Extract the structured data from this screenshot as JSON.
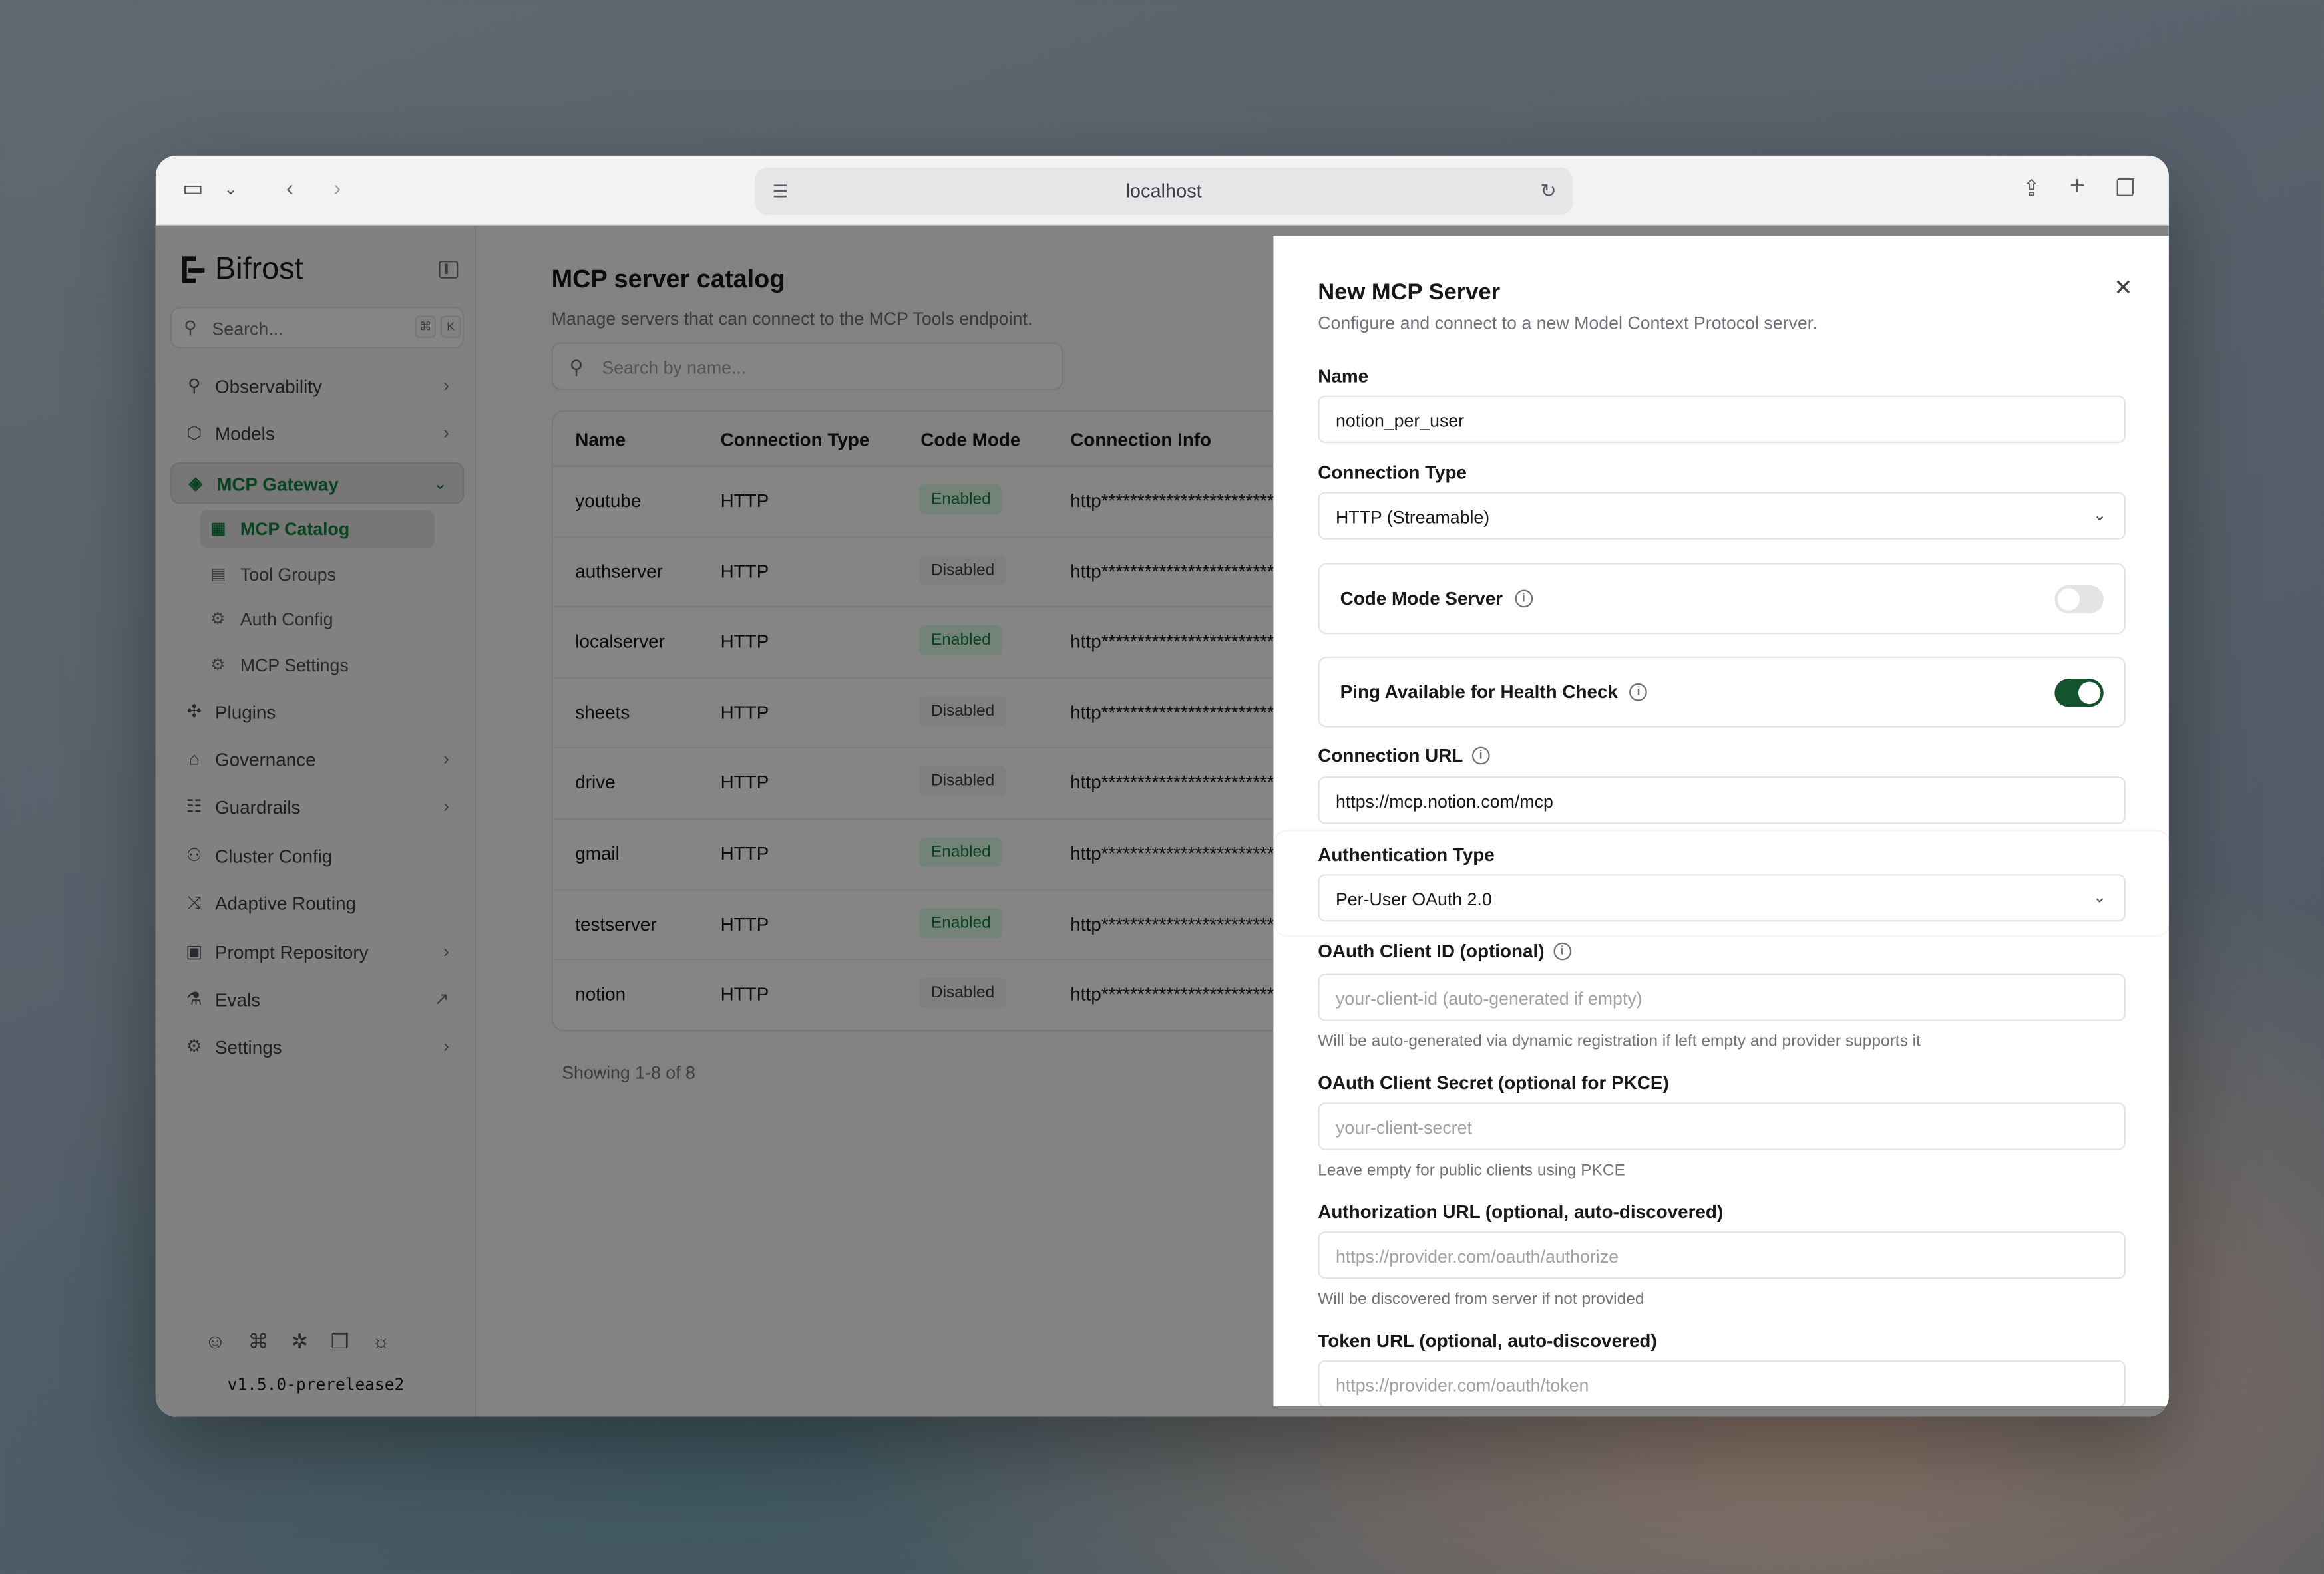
{
  "browser": {
    "url": "localhost"
  },
  "sidebar": {
    "brand": "Bifrost",
    "search_placeholder": "Search...",
    "search_shortcut": [
      "⌘",
      "K"
    ],
    "items": [
      {
        "label": "Observability",
        "icon": "telescope-icon",
        "glyph": "⚲",
        "trailing": "›"
      },
      {
        "label": "Models",
        "icon": "cube-icon",
        "glyph": "⬡",
        "trailing": "›"
      },
      {
        "label": "MCP Gateway",
        "icon": "mcp-icon",
        "glyph": "◈",
        "trailing": "⌄"
      },
      {
        "label": "Plugins",
        "icon": "puzzle-icon",
        "glyph": "✣",
        "trailing": ""
      },
      {
        "label": "Governance",
        "icon": "bank-icon",
        "glyph": "⌂",
        "trailing": "›"
      },
      {
        "label": "Guardrails",
        "icon": "guardrail-icon",
        "glyph": "☷",
        "trailing": "›"
      },
      {
        "label": "Cluster Config",
        "icon": "network-icon",
        "glyph": "⚇",
        "trailing": ""
      },
      {
        "label": "Adaptive Routing",
        "icon": "shuffle-icon",
        "glyph": "⤨",
        "trailing": ""
      },
      {
        "label": "Prompt Repository",
        "icon": "folder-icon",
        "glyph": "▣",
        "trailing": "›"
      },
      {
        "label": "Evals",
        "icon": "flask-icon",
        "glyph": "⚗",
        "trailing": "↗"
      },
      {
        "label": "Settings",
        "icon": "sliders-icon",
        "glyph": "⚙",
        "trailing": "›"
      }
    ],
    "sub_items": [
      {
        "label": "MCP Catalog",
        "icon": "grid-icon",
        "glyph": "▦"
      },
      {
        "label": "Tool Groups",
        "icon": "toolbox-icon",
        "glyph": "▤"
      },
      {
        "label": "Auth Config",
        "icon": "gear-icon",
        "glyph": "⚙"
      },
      {
        "label": "MCP Settings",
        "icon": "cog-icon",
        "glyph": "⚙"
      }
    ],
    "footer_icons": [
      {
        "icon": "discord-icon",
        "glyph": "☺"
      },
      {
        "icon": "github-icon",
        "glyph": "⌘"
      },
      {
        "icon": "bug-icon",
        "glyph": "✲"
      },
      {
        "icon": "book-icon",
        "glyph": "❐"
      },
      {
        "icon": "sun-icon",
        "glyph": "☼"
      }
    ],
    "version": "v1.5.0-prerelease2"
  },
  "catalog": {
    "title": "MCP server catalog",
    "subtitle": "Manage servers that can connect to the MCP Tools endpoint.",
    "search_placeholder": "Search by name...",
    "columns": [
      "Name",
      "Connection Type",
      "Code Mode",
      "Connection Info"
    ],
    "rows": [
      {
        "name": "youtube",
        "type": "HTTP",
        "code_mode": "Enabled",
        "info": "http**************************"
      },
      {
        "name": "authserver",
        "type": "HTTP",
        "code_mode": "Disabled",
        "info": "http**************************"
      },
      {
        "name": "localserver",
        "type": "HTTP",
        "code_mode": "Enabled",
        "info": "http**************************"
      },
      {
        "name": "sheets",
        "type": "HTTP",
        "code_mode": "Disabled",
        "info": "http**************************"
      },
      {
        "name": "drive",
        "type": "HTTP",
        "code_mode": "Disabled",
        "info": "http**************************"
      },
      {
        "name": "gmail",
        "type": "HTTP",
        "code_mode": "Enabled",
        "info": "http**************************"
      },
      {
        "name": "testserver",
        "type": "HTTP",
        "code_mode": "Enabled",
        "info": "http**************************"
      },
      {
        "name": "notion",
        "type": "HTTP",
        "code_mode": "Disabled",
        "info": "http**************************"
      }
    ],
    "showing": "Showing 1-8 of 8"
  },
  "modal": {
    "title": "New MCP Server",
    "subtitle": "Configure and connect to a new Model Context Protocol server.",
    "name_label": "Name",
    "name_value": "notion_per_user",
    "conn_type_label": "Connection Type",
    "conn_type_value": "HTTP (Streamable)",
    "code_mode_label": "Code Mode Server",
    "code_mode_on": false,
    "ping_label": "Ping Available for Health Check",
    "ping_on": true,
    "conn_url_label": "Connection URL",
    "conn_url_value": "https://mcp.notion.com/mcp",
    "auth_type_label": "Authentication Type",
    "auth_type_value": "Per-User OAuth 2.0",
    "client_id_label": "OAuth Client ID (optional)",
    "client_id_placeholder": "your-client-id (auto-generated if empty)",
    "client_id_help": "Will be auto-generated via dynamic registration if left empty and provider supports it",
    "client_secret_label": "OAuth Client Secret (optional for PKCE)",
    "client_secret_placeholder": "your-client-secret",
    "client_secret_help": "Leave empty for public clients using PKCE",
    "auth_url_label": "Authorization URL (optional, auto-discovered)",
    "auth_url_placeholder": "https://provider.com/oauth/authorize",
    "auth_url_help": "Will be discovered from server if not provided",
    "token_url_label": "Token URL (optional, auto-discovered)",
    "token_url_placeholder": "https://provider.com/oauth/token"
  },
  "colors": {
    "accent_green": "#15803d",
    "toggle_on": "#14532d"
  }
}
